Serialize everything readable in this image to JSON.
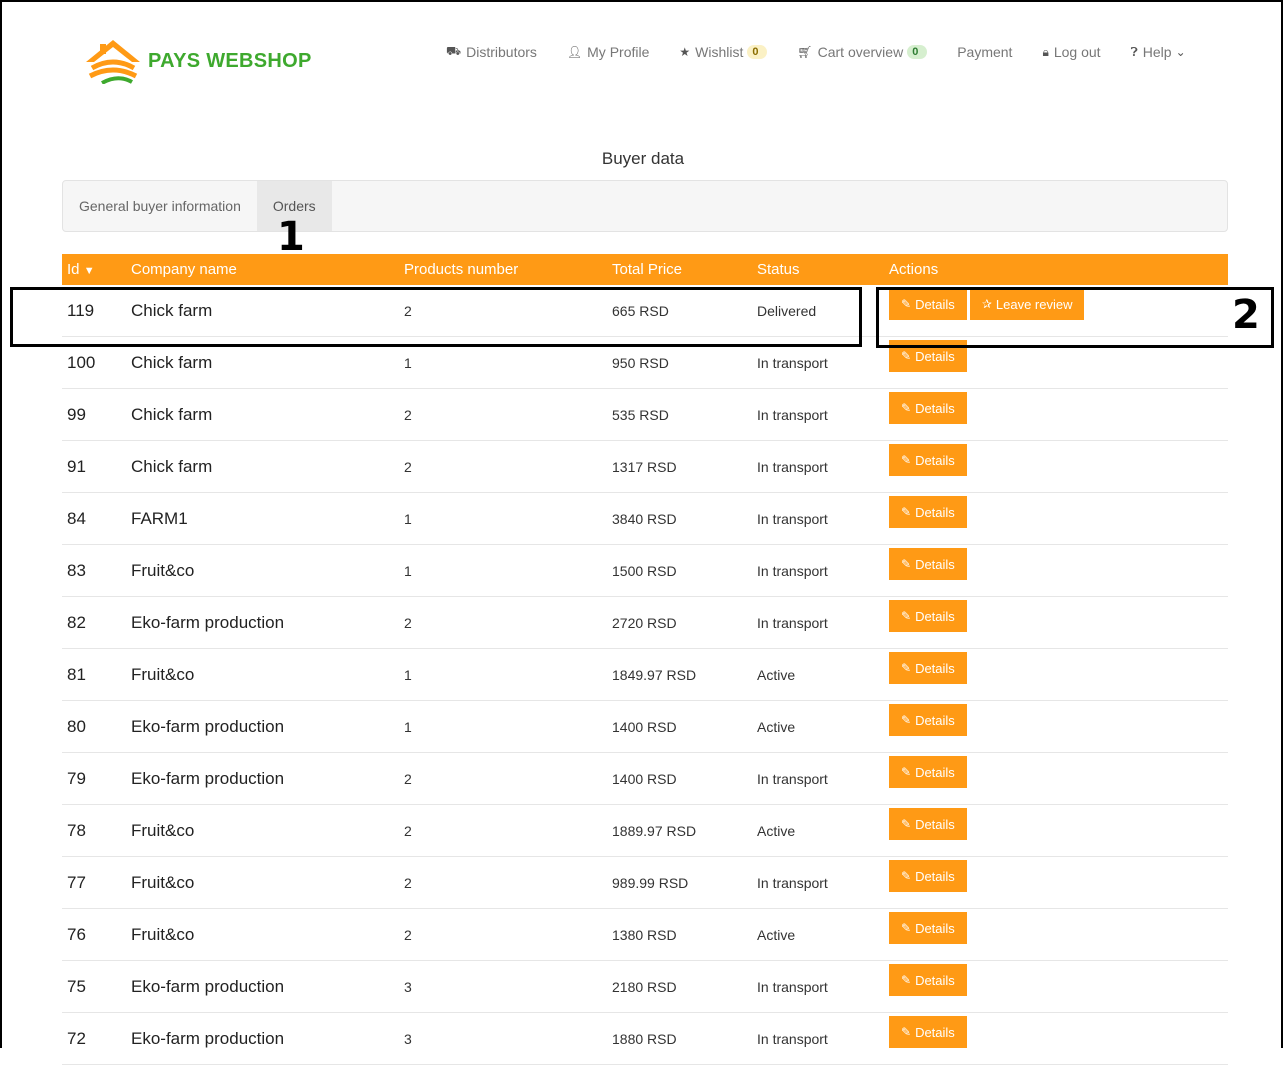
{
  "brand": {
    "name": "PAYS WEBSHOP"
  },
  "nav": {
    "distributors": "Distributors",
    "profile": "My Profile",
    "wishlist": "Wishlist",
    "wishlist_count": "0",
    "cart": "Cart overview",
    "cart_count": "0",
    "payment": "Payment",
    "logout": "Log out",
    "help": "Help"
  },
  "page": {
    "title": "Buyer data"
  },
  "tabs": {
    "general": "General buyer information",
    "orders": "Orders"
  },
  "markers": {
    "one": "1",
    "two": "2"
  },
  "table": {
    "headers": {
      "id": "Id",
      "company": "Company name",
      "products": "Products number",
      "price": "Total Price",
      "status": "Status",
      "actions": "Actions"
    },
    "details_label": "Details",
    "review_label": "Leave review",
    "rows": [
      {
        "id": "119",
        "company": "Chick farm",
        "products": "2",
        "price": "665 RSD",
        "status": "Delivered"
      },
      {
        "id": "100",
        "company": "Chick farm",
        "products": "1",
        "price": "950 RSD",
        "status": "In transport"
      },
      {
        "id": "99",
        "company": "Chick farm",
        "products": "2",
        "price": "535 RSD",
        "status": "In transport"
      },
      {
        "id": "91",
        "company": "Chick farm",
        "products": "2",
        "price": "1317 RSD",
        "status": "In transport"
      },
      {
        "id": "84",
        "company": "FARM1",
        "products": "1",
        "price": "3840 RSD",
        "status": "In transport"
      },
      {
        "id": "83",
        "company": "Fruit&co",
        "products": "1",
        "price": "1500 RSD",
        "status": "In transport"
      },
      {
        "id": "82",
        "company": "Eko-farm production",
        "products": "2",
        "price": "2720 RSD",
        "status": "In transport"
      },
      {
        "id": "81",
        "company": "Fruit&co",
        "products": "1",
        "price": "1849.97 RSD",
        "status": "Active"
      },
      {
        "id": "80",
        "company": "Eko-farm production",
        "products": "1",
        "price": "1400 RSD",
        "status": "Active"
      },
      {
        "id": "79",
        "company": "Eko-farm production",
        "products": "2",
        "price": "1400 RSD",
        "status": "In transport"
      },
      {
        "id": "78",
        "company": "Fruit&co",
        "products": "2",
        "price": "1889.97 RSD",
        "status": "Active"
      },
      {
        "id": "77",
        "company": "Fruit&co",
        "products": "2",
        "price": "989.99 RSD",
        "status": "In transport"
      },
      {
        "id": "76",
        "company": "Fruit&co",
        "products": "2",
        "price": "1380 RSD",
        "status": "Active"
      },
      {
        "id": "75",
        "company": "Eko-farm production",
        "products": "3",
        "price": "2180 RSD",
        "status": "In transport"
      },
      {
        "id": "72",
        "company": "Eko-farm production",
        "products": "3",
        "price": "1880 RSD",
        "status": "In transport"
      }
    ]
  }
}
